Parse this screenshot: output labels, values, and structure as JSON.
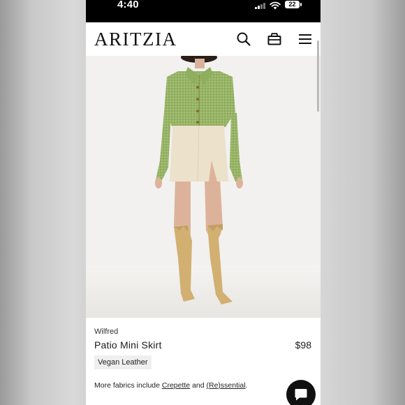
{
  "status_bar": {
    "time": "4:40",
    "battery": "22"
  },
  "header": {
    "logo": "ARITZIA",
    "icons": [
      "search-icon",
      "bag-icon",
      "menu-icon"
    ]
  },
  "product": {
    "brand": "Wilfred",
    "name": "Patio Mini Skirt",
    "price": "$98",
    "material_chip": "Vegan Leather",
    "fabrics_prefix": "More fabrics include ",
    "fabric_link_1": "Crepette",
    "fabrics_and": " and ",
    "fabric_link_2": "(Re)ssential",
    "fabrics_suffix": "."
  },
  "colors": {
    "status_bar_bg": "#000000",
    "page_bg": "#ffffff",
    "hero_bg": "#f2f1ef",
    "chip_bg": "#efefef",
    "chat_button": "#111111"
  },
  "chat_button_icon": "chat-bubble-icon"
}
